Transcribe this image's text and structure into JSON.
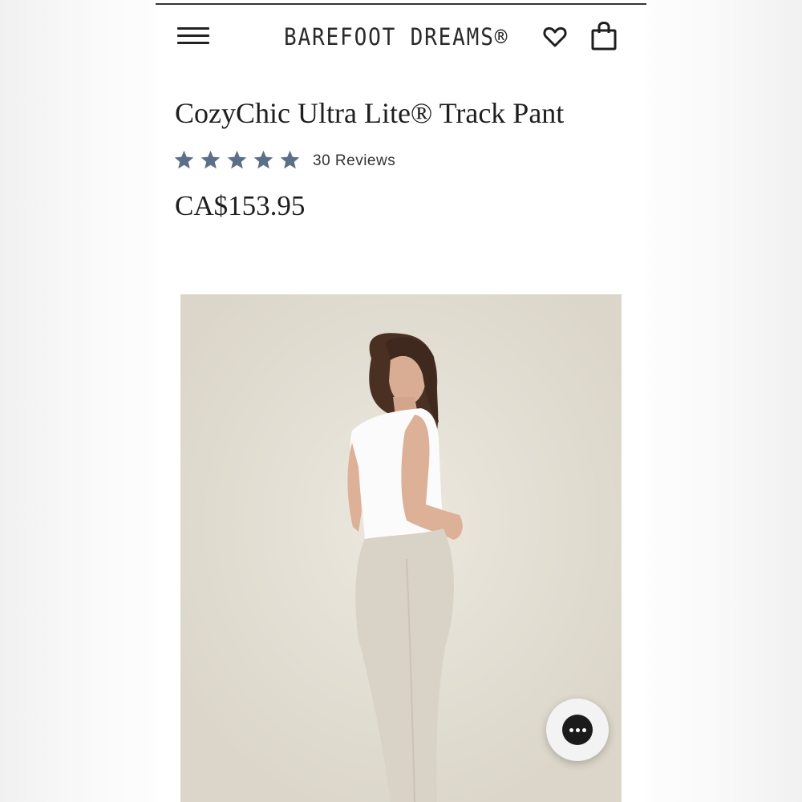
{
  "header": {
    "brand": "BAREFOOT DREAMS®",
    "menu_icon": "hamburger-menu-icon",
    "wishlist_icon": "heart-icon",
    "cart_icon": "shopping-bag-icon"
  },
  "product": {
    "title": "CozyChic Ultra Lite® Track Pant",
    "rating_stars": 5,
    "rating_max": 5,
    "reviews_label": "30 Reviews",
    "price": "CA$153.95",
    "image_alt_icon": "product-photo"
  },
  "chat": {
    "icon": "chat-bubble-icon"
  },
  "colors": {
    "star": "#5b7088",
    "text": "#1e1e1e",
    "photo_bg": "#e4dfd3",
    "top_white": "#fbfbfb",
    "pants": "#d9d2c6"
  }
}
